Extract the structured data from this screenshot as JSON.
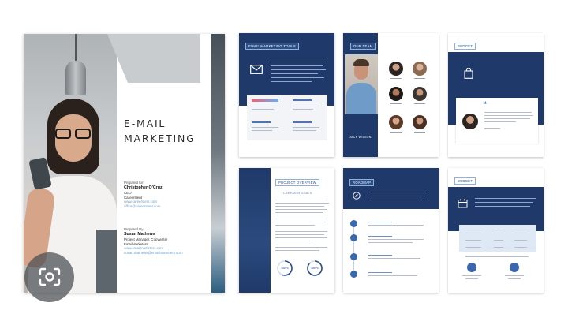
{
  "cover": {
    "title_line1": "E-MAIL",
    "title_line2": "MARKETING",
    "prepared_for_label": "Prepared for:",
    "prepared_for_name": "Christopher O'Cruz",
    "prepared_for_role": "CEO",
    "prepared_for_company": "Careerstent",
    "prepared_for_web": "www.careerstent.com",
    "prepared_for_email": "office@careerstent.com",
    "prepared_by_label": "Prepared By",
    "prepared_by_name": "Susan Mathews",
    "prepared_by_role": "Project Manager, Copywriter",
    "prepared_by_company": "EmailMarketers",
    "prepared_by_web": "www.emailmarketers.com",
    "prepared_by_email": "susan.mathews@emailmarketers.com"
  },
  "pages": {
    "marketing_tools": {
      "title": "EMAIL MARKETING TOOLS"
    },
    "our_team": {
      "title": "OUR TEAM",
      "lead_name": "JACK WILSON"
    },
    "budget_top": {
      "title": "BUDGET"
    },
    "project_overview": {
      "title": "PROJECT OVERVIEW",
      "subtitle": "CAMPAIGN GOALS",
      "stat1": "55%",
      "stat2": "86%"
    },
    "roadmap": {
      "title": "ROADMAP"
    },
    "budget_bottom": {
      "title": "BUDGET"
    }
  },
  "icons": {
    "envelope": "envelope-icon",
    "bag": "shopping-bag-icon",
    "quote": "quote-icon",
    "calendar": "calendar-icon",
    "camera": "camera-search-icon"
  },
  "colors": {
    "navy": "#1f3a6a",
    "accent": "#2d4f8a",
    "light_blue": "#dfe8f5"
  }
}
